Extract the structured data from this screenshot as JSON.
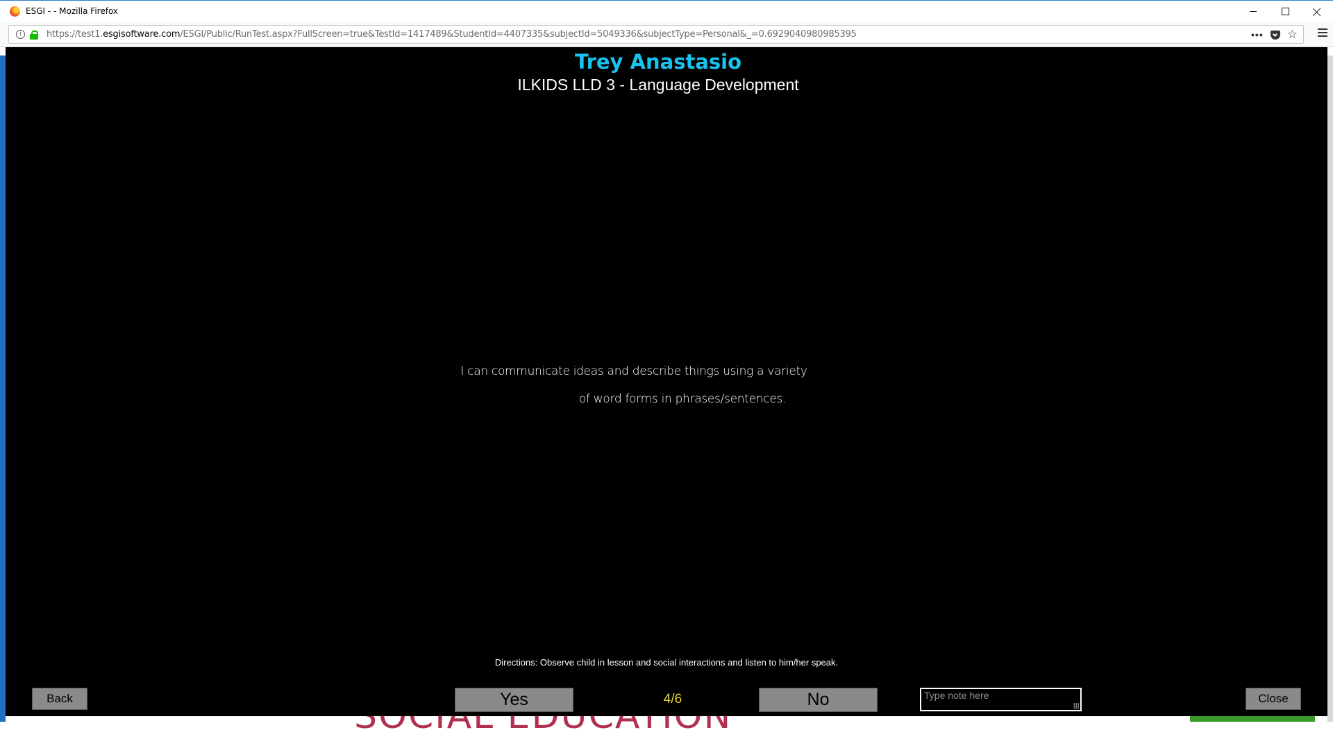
{
  "window": {
    "title": "ESGI - - Mozilla Firefox"
  },
  "browser": {
    "url_prefix": "https://test1.",
    "url_domain": "esgisoftware.com",
    "url_path": "/ESGI/Public/RunTest.aspx?FullScreen=true&TestId=1417489&StudentId=4407335&subjectId=5049336&subjectType=Personal&_=0.6929040980985395",
    "page_actions_label": "•••"
  },
  "test": {
    "student_name": "Trey Anastasio",
    "test_name": "ILKIDS LLD 3 - Language Development",
    "question_line1": "I can communicate ideas and describe things using a variety",
    "question_line2": "of word forms in phrases/sentences.",
    "directions": "Directions: Observe child in lesson and social interactions and listen to him/her speak.",
    "progress": "4/6"
  },
  "controls": {
    "back_label": "Back",
    "yes_label": "Yes",
    "no_label": "No",
    "close_label": "Close",
    "note_placeholder": "Type note here",
    "note_value": ""
  },
  "background": {
    "partial_text": "SOCIAL EDUCATION"
  },
  "colors": {
    "stage_bg": "#000000",
    "student_name": "#19c3f0",
    "progress": "#e8d43a",
    "button_bg": "#8a8a8a"
  }
}
